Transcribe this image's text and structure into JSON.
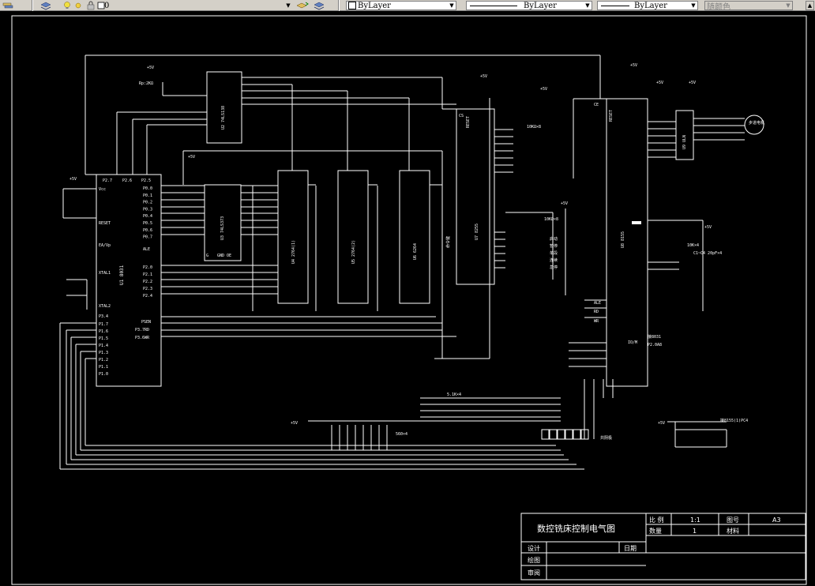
{
  "toolbar": {
    "layer_value": "0",
    "color_value": "ByLayer",
    "linetype_value": "ByLayer",
    "lineweight_value": "ByLayer",
    "plotstyle_value": "随颜色"
  },
  "power": {
    "vcc": "+5V"
  },
  "chips": {
    "mcu": {
      "name": "U1 8031",
      "pins_p0": [
        "P0.0",
        "P0.1",
        "P0.2",
        "P0.3",
        "P0.4",
        "P0.5",
        "P0.6",
        "P0.7"
      ],
      "pins_p2": [
        "P2.0",
        "P2.1",
        "P2.2",
        "P2.3",
        "P2.4"
      ],
      "pins_p1": [
        "P1.7",
        "P1.6",
        "P1.5",
        "P1.4",
        "P1.3",
        "P1.2",
        "P1.1",
        "P1.0"
      ],
      "reset": "RESET",
      "ale": "ALE",
      "psen": "PSEN",
      "rd": "P3.7RD",
      "wr": "P3.6WR",
      "ea": "EA/Vp",
      "xtal1": "XTAL1",
      "xtal2": "XTAL2",
      "p34": "P3.4",
      "p27": "P2.7",
      "p26": "P2.6",
      "p25": "P2.5",
      "vcc": "Vcc"
    },
    "decoder": {
      "name": "U2 74LS138"
    },
    "latch": {
      "name": "U3 74LS373",
      "oe": "GND OE",
      "g": "G"
    },
    "eprom1": {
      "name": "U4 2764(1)"
    },
    "eprom2": {
      "name": "U5 2764(2)"
    },
    "ram": {
      "name": "U6 6264"
    },
    "pio": {
      "name": "U7 8255"
    },
    "io8155": {
      "name": "U8 8155"
    },
    "driver": {
      "name": "U9 ULN"
    }
  },
  "labels": {
    "rp": "Rp:2KΩ",
    "res_array1": "10KΩ×8",
    "res_array2": "10KΩ×8",
    "res_4": "10K×4",
    "cap": "C1~C4 20pF×4",
    "res_51": "5.1K×4",
    "res_560": "560×4",
    "display": "共阴极",
    "motor": "步进电机",
    "to8031": "接8031",
    "to_p20a8": "P2.0A8",
    "io_m": "IO/M",
    "to8155": "接8155(1)PC4",
    "keys_left": "命令键",
    "keys": [
      "启动",
      "暂停",
      "单段",
      "连续",
      "急停"
    ],
    "gnd": "GND",
    "ale": "ALE",
    "rd": "RD",
    "wr": "WR",
    "reset": "RESET",
    "cs": "CS",
    "ce": "CE"
  },
  "title_block": {
    "title": "数控铣床控制电气图",
    "scale_label": "比 例",
    "scale_value": "1:1",
    "drawing_no_label": "图号",
    "drawing_no_value": "A3",
    "qty_label": "数量",
    "qty_value": "1",
    "material_label": "材料",
    "design_label": "设计",
    "date_label": "日期",
    "draw_label": "绘图",
    "review_label": "审阅"
  }
}
